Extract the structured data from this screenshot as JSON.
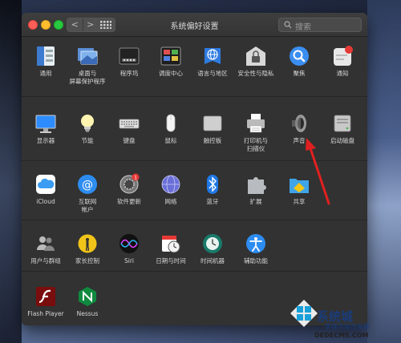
{
  "window": {
    "title": "系统偏好设置"
  },
  "nav": {
    "back": "<",
    "forward": ">"
  },
  "search": {
    "placeholder": "搜索"
  },
  "rows": [
    [
      {
        "label": "通用",
        "icon": "general-icon"
      },
      {
        "label": "桌面与\n屏幕保护程序",
        "icon": "desktop-icon"
      },
      {
        "label": "程序坞",
        "icon": "dock-icon"
      },
      {
        "label": "调度中心",
        "icon": "mission-control-icon"
      },
      {
        "label": "语言与地区",
        "icon": "language-icon"
      },
      {
        "label": "安全性与隐私",
        "icon": "security-icon"
      },
      {
        "label": "聚焦",
        "icon": "spotlight-icon"
      },
      {
        "label": "通知",
        "icon": "notifications-icon"
      }
    ],
    [
      {
        "label": "显示器",
        "icon": "display-icon"
      },
      {
        "label": "节能",
        "icon": "energy-icon"
      },
      {
        "label": "键盘",
        "icon": "keyboard-icon"
      },
      {
        "label": "鼠标",
        "icon": "mouse-icon"
      },
      {
        "label": "触控板",
        "icon": "trackpad-icon"
      },
      {
        "label": "打印机与\n扫描仪",
        "icon": "printer-icon"
      },
      {
        "label": "声音",
        "icon": "sound-icon"
      },
      {
        "label": "启动磁盘",
        "icon": "startup-disk-icon"
      }
    ],
    [
      {
        "label": "iCloud",
        "icon": "icloud-icon"
      },
      {
        "label": "互联网\n帐户",
        "icon": "internet-accounts-icon"
      },
      {
        "label": "软件更新",
        "icon": "software-update-icon",
        "badge": "1"
      },
      {
        "label": "网络",
        "icon": "network-icon"
      },
      {
        "label": "蓝牙",
        "icon": "bluetooth-icon"
      },
      {
        "label": "扩展",
        "icon": "extensions-icon"
      },
      {
        "label": "共享",
        "icon": "sharing-icon"
      }
    ],
    [
      {
        "label": "用户与群组",
        "icon": "users-icon"
      },
      {
        "label": "家长控制",
        "icon": "parental-icon"
      },
      {
        "label": "Siri",
        "icon": "siri-icon"
      },
      {
        "label": "日期与时间",
        "icon": "datetime-icon"
      },
      {
        "label": "时间机器",
        "icon": "time-machine-icon"
      },
      {
        "label": "辅助功能",
        "icon": "accessibility-icon"
      }
    ],
    [
      {
        "label": "Flash Player",
        "icon": "flash-icon"
      },
      {
        "label": "Nessus",
        "icon": "nessus-icon"
      }
    ]
  ],
  "watermark": {
    "text": "系统城",
    "sub": "梦蝶内容告系统",
    "url": "DEDECMS.COM"
  },
  "colors": {
    "window_bg": "#323232",
    "arrow": "#e02020"
  }
}
